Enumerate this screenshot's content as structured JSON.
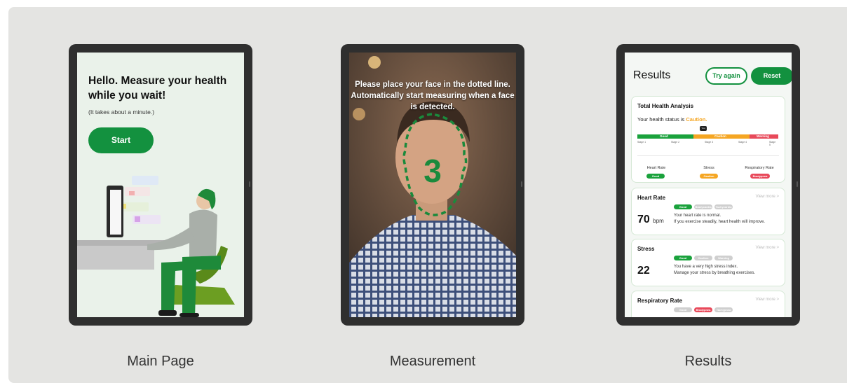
{
  "screens": [
    {
      "caption": "Main Page"
    },
    {
      "caption": "Measurement"
    },
    {
      "caption": "Results"
    }
  ],
  "main_page": {
    "headline": "Hello. Measure your health while you wait!",
    "subtitle": "(It takes about a minute.)",
    "start_label": "Start"
  },
  "measurement": {
    "instruction": "Please place your face in the dotted line. Automatically start measuring when a face is detected.",
    "countdown": "3"
  },
  "results": {
    "title": "Results",
    "try_again_label": "Try again",
    "reset_label": "Reset",
    "total": {
      "title": "Total Health Analysis",
      "status_prefix": "Your health status is ",
      "status_value": "Caution.",
      "bar_labels": [
        "Good",
        "Caution",
        "Warning"
      ],
      "marker": "You",
      "stages": [
        "Stage 1",
        "Stage 2",
        "Stage 3",
        "Stage 4",
        "Stage 5"
      ],
      "columns": [
        {
          "label": "Heart Rate",
          "status": "Good"
        },
        {
          "label": "Stress",
          "status": "Caution"
        },
        {
          "label": "Respiratory Rate",
          "status": "Bradypnea"
        }
      ]
    },
    "heart_rate": {
      "title": "Heart Rate",
      "view_more": "View more >",
      "value": "70",
      "unit": "bpm",
      "pills": [
        "Good",
        "Bradycardia",
        "Tachycardia"
      ],
      "desc1": "Your heart rate is normal.",
      "desc2": "If you exercise steadily, heart health will improve."
    },
    "stress": {
      "title": "Stress",
      "view_more": "View more >",
      "value": "22",
      "pills": [
        "Good",
        "Caution",
        "Warning"
      ],
      "desc1": "You have a very high stress index.",
      "desc2": "Manage your stress by breathing exercises."
    },
    "respiratory": {
      "title": "Respiratory Rate",
      "view_more": "View more >",
      "pills": [
        "Good",
        "Bradypnea",
        "Tachypnea"
      ]
    }
  },
  "colors": {
    "primary_green": "#13913f",
    "caution_orange": "#f5a623",
    "warning_red": "#e8495a",
    "panel_bg": "#e4e4e2"
  }
}
